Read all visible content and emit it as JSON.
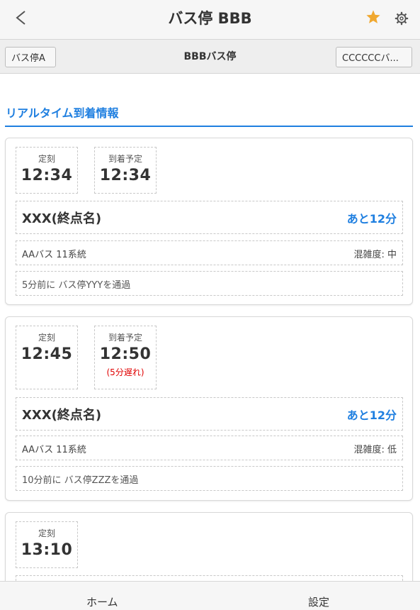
{
  "header": {
    "title": "バス停 BBB",
    "back_icon": "chevron-left-icon",
    "favorite_icon": "star-icon",
    "settings_icon": "gear-icon",
    "accent_color": "#f0a830"
  },
  "subnav": {
    "prev_label": "バス停A",
    "title": "BBBバス停",
    "next_label": "CCCCCCバ..."
  },
  "section": {
    "title": "リアルタイム到着情報",
    "color": "#1f7fe0"
  },
  "arrivals": [
    {
      "scheduled_label": "定刻",
      "scheduled": "12:34",
      "expected_label": "到着予定",
      "expected": "12:34",
      "destination": "XXX(終点名)",
      "remaining": "あと12分",
      "route": "AAバス 11系統",
      "congestion": "混雑度: 中",
      "passed": "5分前に バス停YYYを通過"
    },
    {
      "scheduled_label": "定刻",
      "scheduled": "12:45",
      "expected_label": "到着予定",
      "expected": "12:50",
      "delay": "(5分遅れ)",
      "destination": "XXX(終点名)",
      "remaining": "あと12分",
      "route": "AAバス 11系統",
      "congestion": "混雑度: 低",
      "passed": "10分前に バス停ZZZを通過"
    },
    {
      "scheduled_label": "定刻",
      "scheduled": "13:10"
    }
  ],
  "footer": {
    "home_label": "ホーム",
    "settings_label": "設定"
  }
}
